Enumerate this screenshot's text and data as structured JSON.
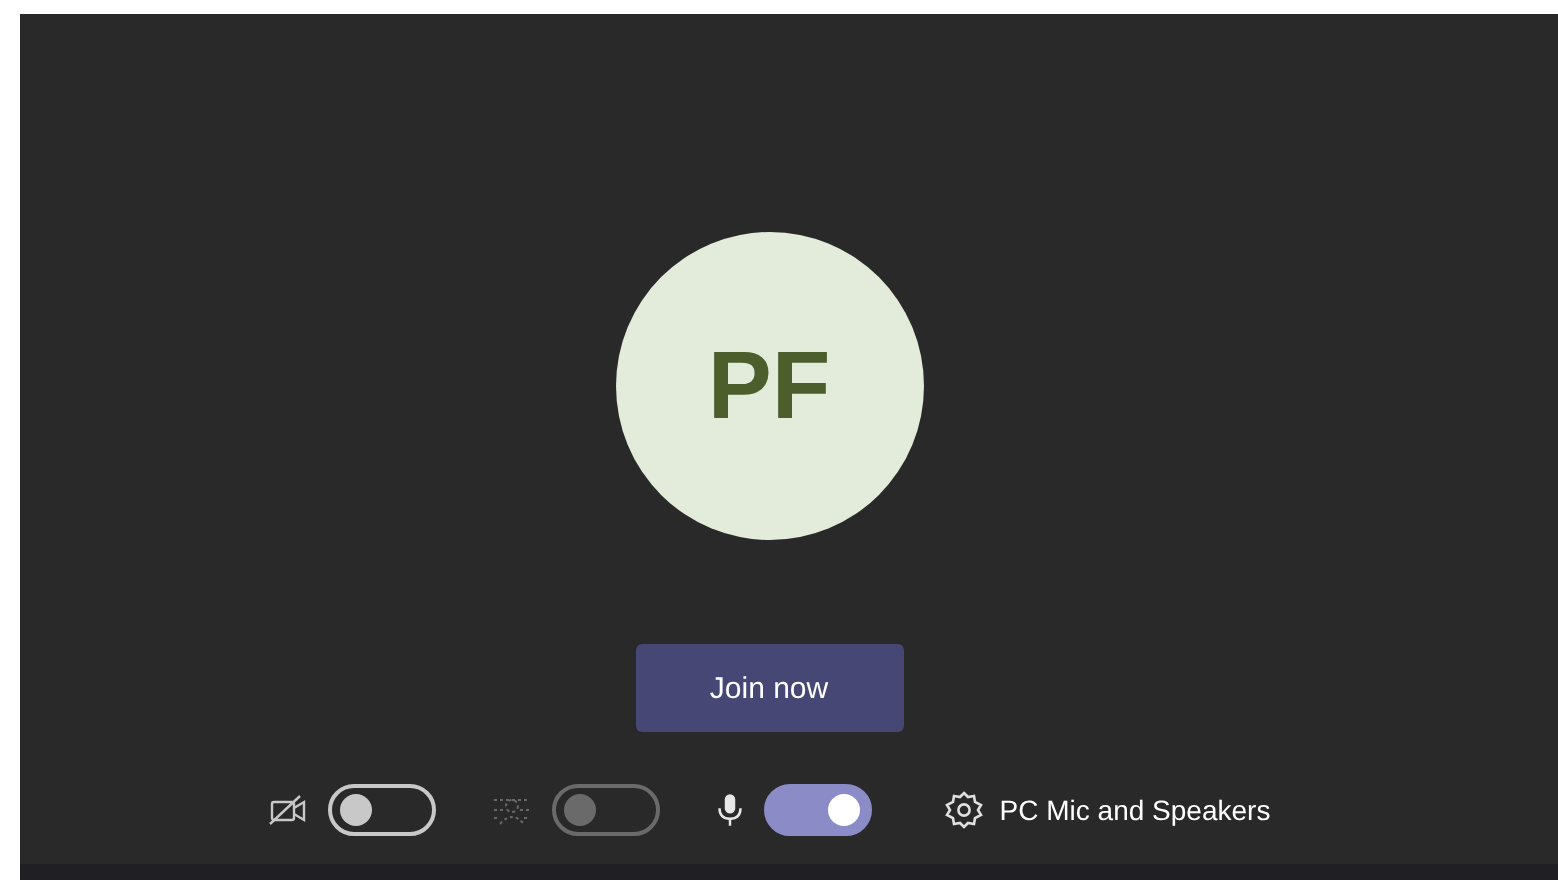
{
  "avatar": {
    "initials": "PF"
  },
  "join_button": {
    "label": "Join now"
  },
  "controls": [
    {
      "kind": "camera",
      "on": false,
      "disabled": false
    },
    {
      "kind": "blur",
      "on": false,
      "disabled": true
    },
    {
      "kind": "mic",
      "on": true,
      "disabled": false
    }
  ],
  "device_settings": {
    "label": "PC Mic and Speakers"
  }
}
